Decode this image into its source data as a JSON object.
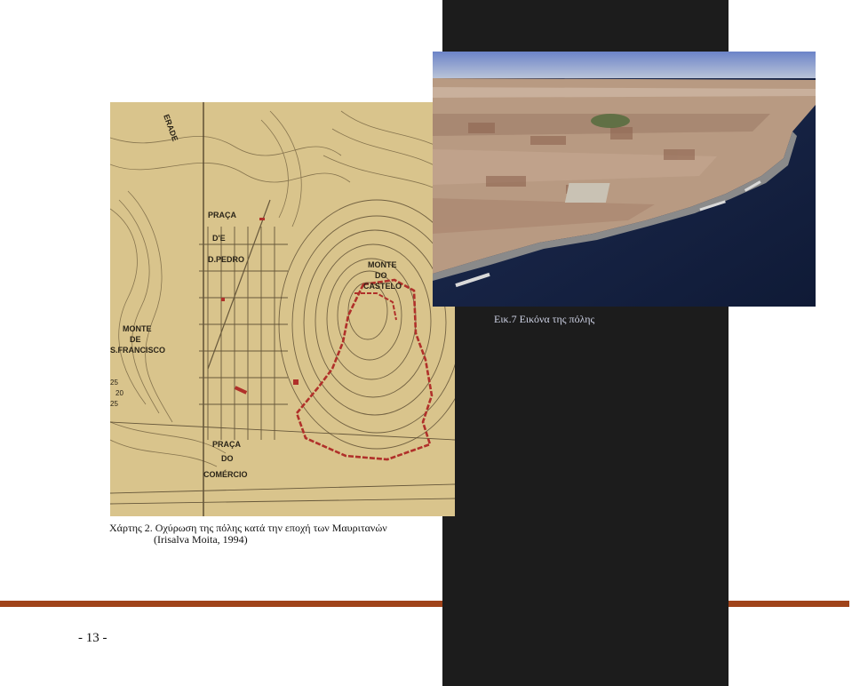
{
  "figures": {
    "photo": {
      "caption": "Εικ.7 Εικόνα της  πόλης",
      "alt": "aerial-city-photo"
    },
    "map": {
      "caption_line1": "Χάρτης 2. Οχύρωση της πόλης κατά την εποχή των Μαυριτανών",
      "caption_line2": "(Irisalva Moita, 1994)",
      "labels": {
        "praca_dom_pedro": [
          "PRAÇA",
          "D'E",
          "D.PEDRO"
        ],
        "monte_castelo": [
          "MONTE",
          "DO",
          "CASTELO"
        ],
        "monte_francisco": [
          "MONTE",
          "DE",
          "S.FRANCISCO"
        ],
        "praca_comercio": [
          "PRAÇA",
          "DO",
          "COMÉRCIO"
        ],
        "street_top": "ERADE",
        "numbers": [
          "25",
          "20",
          "25"
        ]
      },
      "wall_color": "#b0302a"
    }
  },
  "page": {
    "number": "- 13 -"
  },
  "colors": {
    "rule": "#a0431a",
    "dark_column": "#1c1c1c",
    "map_paper": "#d9c48c"
  }
}
